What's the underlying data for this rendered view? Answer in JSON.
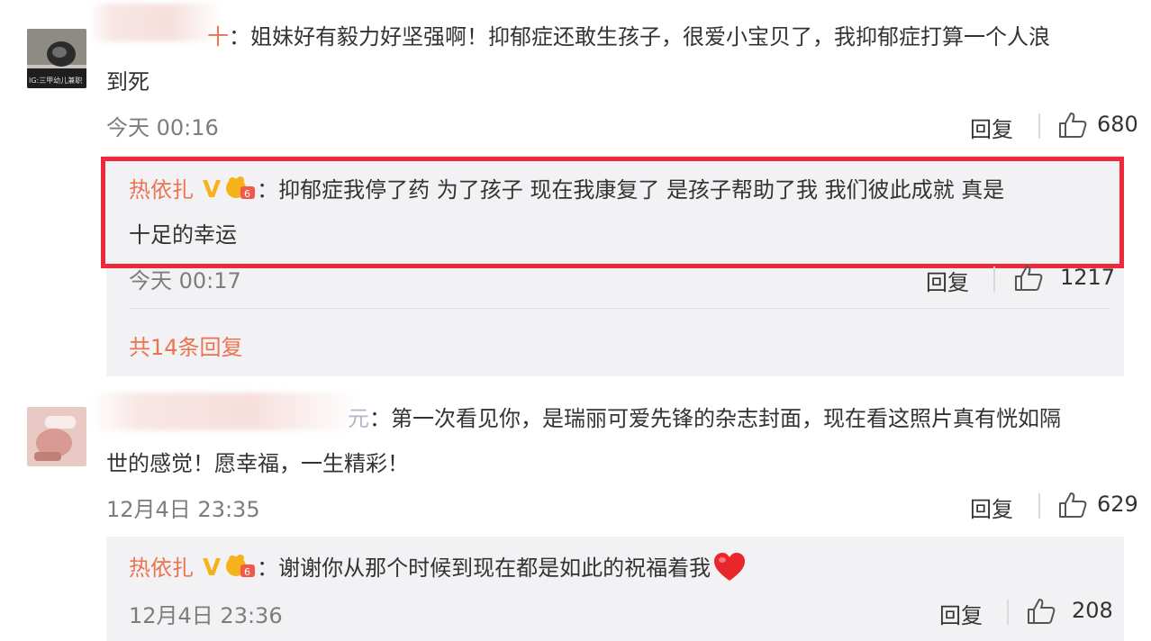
{
  "comment1": {
    "name_tail": "十",
    "text_line1": "：姐妹好有毅力好坚强啊！抑郁症还敢生孩子，很爱小宝贝了，我抑郁症打算一个人浪",
    "text_line2": "到死",
    "time": "今天 00:16",
    "reply_label": "回复",
    "likes": "680",
    "avatar_caption": "IG:三甲幼儿兼职",
    "reply": {
      "name": "热依扎",
      "v_badge": "V",
      "text_line1": "：抑郁症我停了药 为了孩子 现在我康复了 是孩子帮助了我 我们彼此成就 真是",
      "text_line2": "十足的幸运",
      "time": "今天 00:17",
      "reply_label": "回复",
      "likes": "1217"
    },
    "more_replies": "共14条回复"
  },
  "comment2": {
    "name_tail": "元",
    "text_line1": "：第一次看见你，是瑞丽可爱先锋的杂志封面，现在看这照片真有恍如隔",
    "text_line2": "世的感觉！愿幸福，一生精彩！",
    "time": "12月4日 23:35",
    "reply_label": "回复",
    "likes": "629",
    "reply": {
      "name": "热依扎",
      "v_badge": "V",
      "text": "：谢谢你从那个时候到现在都是如此的祝福着我",
      "time": "12月4日 23:36",
      "reply_label": "回复",
      "likes": "208"
    }
  },
  "colors": {
    "accent": "#eb7350",
    "highlight_border": "#f0283c",
    "reply_bg": "#f2f2f5",
    "meta": "#7d7d7d"
  }
}
